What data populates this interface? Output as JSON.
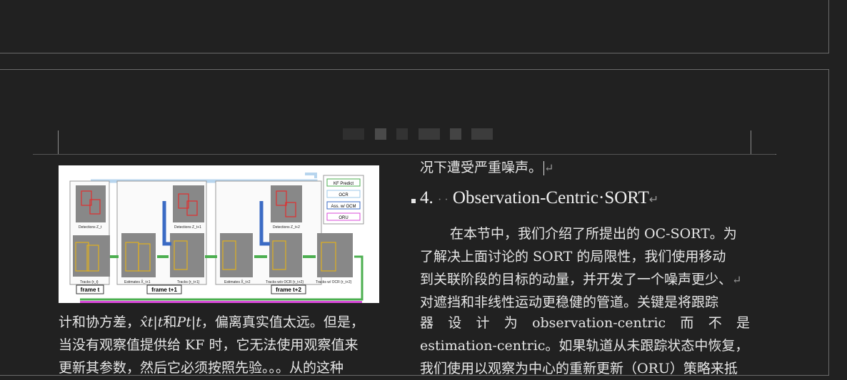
{
  "left_column": {
    "line1": "计和协方差，",
    "math1": "x̂t|t",
    "and": "和",
    "math2": "Pt|t",
    "line1_tail": "，偏离真实值太远。但是，",
    "line2": "当没有观察值提供给 KF 时，它无法使用观察值来",
    "line3": "更新其参数，然后它必须按照先验。。。从的这种"
  },
  "figure": {
    "legend": [
      "KF Predict",
      "OCR",
      "Ass. w/ OCM",
      "ORU"
    ],
    "legend_colors": [
      "#4caf50",
      "#9ec9ea",
      "#3b6bc4",
      "#d84bd8"
    ],
    "panel_labels": [
      "Detections Z_t",
      "Tracks {τ_t}",
      "Detections Z_t+1",
      "Estimates X̂_t+1",
      "Tracks {τ_t+1}",
      "Detections Z_t+2",
      "Estimates X̂_t+2",
      "Tracks w/o OCR {τ_t+2}",
      "Tracks w/ OCR {τ_t+2}"
    ],
    "frame_labels": [
      "frame t",
      "frame t+1",
      "frame t+2"
    ]
  },
  "right_column": {
    "line0": "况下遭受严重噪声。",
    "heading_number": "4.",
    "heading_dots": "· ·",
    "heading_title": "Observation-Centric·SORT",
    "para_lines": [
      "在本节中，我们介绍了所提出的 OC-SORT。为",
      "了解决上面讨论的 SORT 的局限性，我们使用移动",
      "到关联阶段的目标的动量，并开发了一个噪声更少、",
      "对遮挡和非线性运动更稳健的管道。关键是将跟踪"
    ],
    "justified_line": [
      "器",
      "设",
      "计",
      "为",
      "observation-centric",
      "而",
      "不",
      "是"
    ],
    "line6": "estimation-centric。如果轨道从未跟踪状态中恢复，",
    "line7": "我们使用以观察为中心的重新更新（ORU）策略来抵"
  },
  "marks": {
    "return": "↵"
  }
}
